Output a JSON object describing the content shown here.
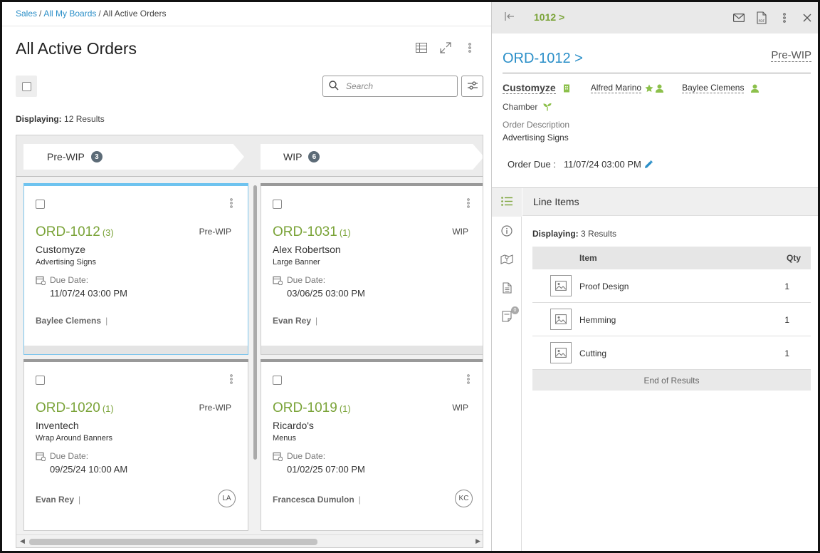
{
  "breadcrumb": {
    "sales": "Sales",
    "boards": "All My Boards",
    "current": "All Active Orders"
  },
  "page_title": "All Active Orders",
  "search": {
    "placeholder": "Search"
  },
  "displaying": {
    "label": "Displaying:",
    "text": "12 Results"
  },
  "stages": [
    {
      "label": "Pre-WIP",
      "count": "3"
    },
    {
      "label": "WIP",
      "count": "6"
    }
  ],
  "cards": [
    {
      "order": "ORD-1012",
      "count": "(3)",
      "status": "Pre-WIP",
      "customer": "Customyze",
      "description": "Advertising Signs",
      "due_label": "Due Date:",
      "due": "11/07/24 03:00 PM",
      "owner": "Baylee Clemens",
      "avatar": ""
    },
    {
      "order": "ORD-1031",
      "count": "(1)",
      "status": "WIP",
      "customer": "Alex Robertson",
      "description": "Large Banner",
      "due_label": "Due Date:",
      "due": "03/06/25 03:00 PM",
      "owner": "Evan Rey",
      "avatar": ""
    },
    {
      "order": "ORD-1020",
      "count": "(1)",
      "status": "Pre-WIP",
      "customer": "Inventech",
      "description": "Wrap Around Banners",
      "due_label": "Due Date:",
      "due": "09/25/24 10:00 AM",
      "owner": "Evan Rey",
      "avatar": "LA"
    },
    {
      "order": "ORD-1019",
      "count": "(1)",
      "status": "WIP",
      "customer": "Ricardo's",
      "description": "Menus",
      "due_label": "Due Date:",
      "due": "01/02/25 07:00 PM",
      "owner": "Francesca Dumulon",
      "avatar": "KC"
    }
  ],
  "detail": {
    "crumb": "1012 >",
    "title": "ORD-1012 >",
    "status": "Pre-WIP",
    "customer": "Customyze",
    "salesperson": "Alfred Marino",
    "csr": "Baylee Clemens",
    "source": "Chamber",
    "order_desc_label": "Order Description",
    "order_desc": "Advertising Signs",
    "due_label": "Order Due :",
    "due": "11/07/24 03:00 PM",
    "notes_badge": "0",
    "line_items": {
      "title": "Line Items",
      "displaying_label": "Displaying:",
      "displaying_text": "3 Results",
      "col_item": "Item",
      "col_qty": "Qty",
      "rows": [
        {
          "name": "Proof Design",
          "qty": "1"
        },
        {
          "name": "Hemming",
          "qty": "1"
        },
        {
          "name": "Cutting",
          "qty": "1"
        }
      ],
      "end": "End of Results"
    }
  },
  "colors": {
    "accent_green": "#7aa338",
    "link_blue": "#2b8fc8",
    "icon_green": "#8cc04b"
  },
  "icons": [
    "table-view-icon",
    "expand-icon",
    "kebab-icon",
    "search-icon",
    "filter-icon",
    "calendar-icon",
    "back-arrow-icon",
    "mail-icon",
    "pdf-icon",
    "close-icon",
    "building-icon",
    "star-icon",
    "person-icon",
    "sprout-icon",
    "pencil-icon",
    "list-icon",
    "info-icon",
    "map-icon",
    "document-icon",
    "notes-icon",
    "image-icon"
  ]
}
